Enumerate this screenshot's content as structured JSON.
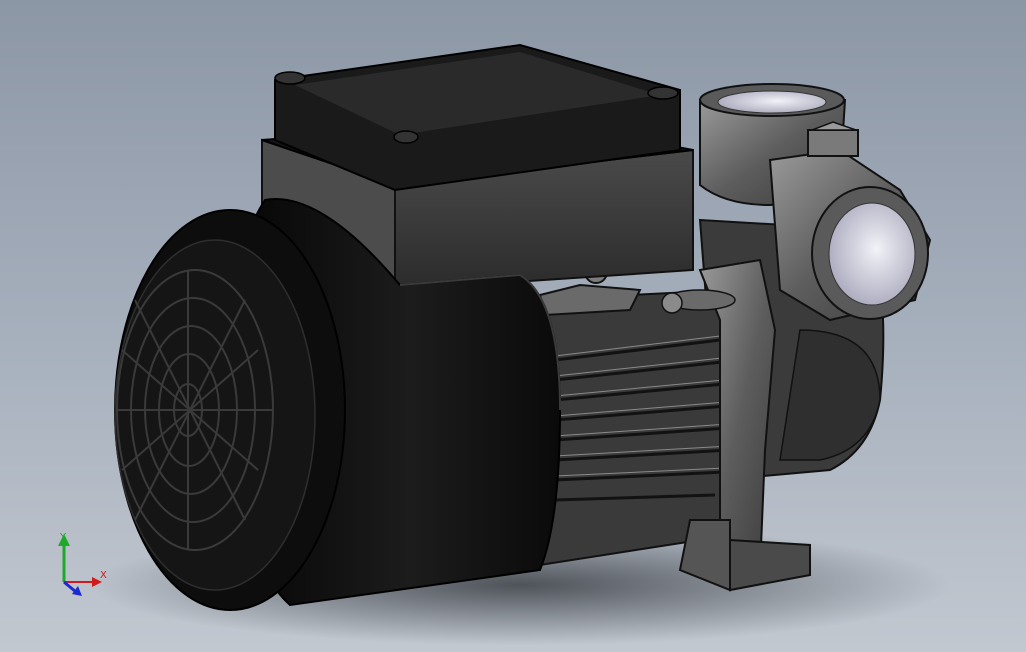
{
  "viewport": {
    "background_top": "#8c97a6",
    "background_bottom": "#c2c8d0"
  },
  "model": {
    "body_color": "#111111",
    "metal_color": "#6e6e6e",
    "metal_highlight": "#b5b5b5",
    "port_inner_color": "#dcdce6"
  },
  "triad": {
    "x_label": "X",
    "y_label": "Y",
    "x_color": "#d11a1a",
    "y_color": "#1fa82a",
    "z_color": "#1a2bd1"
  }
}
